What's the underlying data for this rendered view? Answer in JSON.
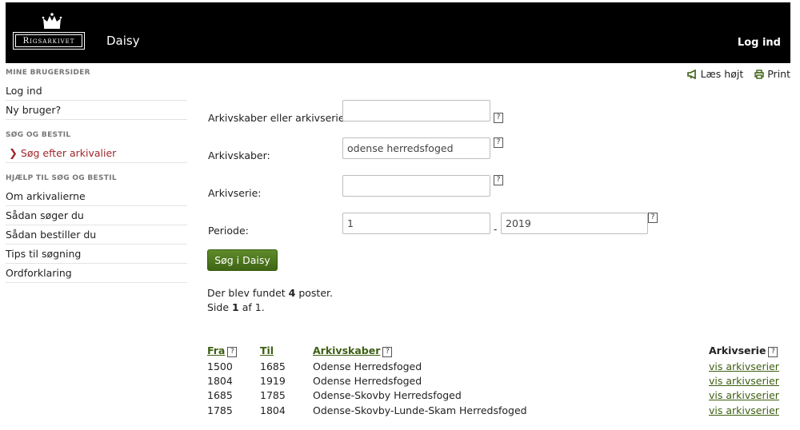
{
  "header": {
    "logo_text": "Rigsarkivet",
    "app_name": "Daisy",
    "login_label": "Log ind"
  },
  "sidebar": {
    "sections": [
      {
        "heading": "MINE BRUGERSIDER",
        "items": [
          "Log ind",
          "Ny bruger?"
        ]
      },
      {
        "heading": "SØG OG BESTIL",
        "items": [
          "Søg efter arkivalier"
        ]
      },
      {
        "heading": "HJÆLP TIL SØG OG BESTIL",
        "items": [
          "Om arkivalierne",
          "Sådan søger du",
          "Sådan bestiller du",
          "Tips til søgning",
          "Ordforklaring"
        ]
      }
    ]
  },
  "tools": {
    "read_aloud": "Læs højt",
    "print": "Print"
  },
  "form": {
    "archive_creator_or_series_label": "Arkivskaber eller arkivserie:",
    "archive_creator_or_series_value": "",
    "archive_creator_label": "Arkivskaber:",
    "archive_creator_value": "odense herredsfoged",
    "archive_series_label": "Arkivserie:",
    "archive_series_value": "",
    "period_label": "Periode:",
    "period_from": "1",
    "period_to": "2019",
    "period_separator": "-",
    "help_glyph": "?",
    "search_button": "Søg i Daisy"
  },
  "results": {
    "found_prefix": "Der blev fundet ",
    "found_count": "4",
    "found_suffix": " poster.",
    "page_prefix": "Side ",
    "page_current": "1",
    "page_mid": " af ",
    "page_total": "1",
    "page_suffix": "."
  },
  "table": {
    "headers": {
      "from": "Fra",
      "to": "Til",
      "creator": "Arkivskaber",
      "series": "Arkivserie"
    },
    "rows": [
      {
        "from": "1500",
        "to": "1685",
        "creator": "Odense Herredsfoged",
        "series": "vis arkivserier"
      },
      {
        "from": "1804",
        "to": "1919",
        "creator": "Odense Herredsfoged",
        "series": "vis arkivserier"
      },
      {
        "from": "1685",
        "to": "1785",
        "creator": "Odense-Skovby Herredsfoged",
        "series": "vis arkivserier"
      },
      {
        "from": "1785",
        "to": "1804",
        "creator": "Odense-Skovby-Lunde-Skam Herredsfoged",
        "series": "vis arkivserier"
      }
    ]
  },
  "colors": {
    "header_bg": "#000000",
    "link_green": "#3d5f12",
    "button_green": "#4a7219",
    "active_red": "#a0262b"
  }
}
